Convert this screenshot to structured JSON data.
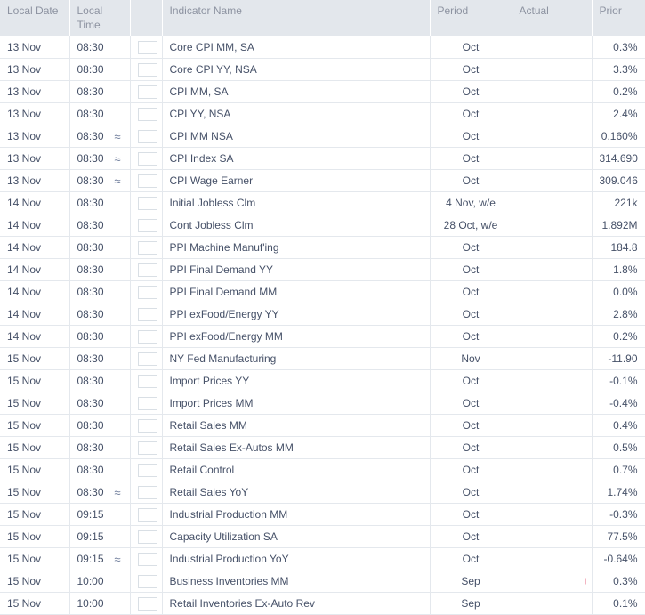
{
  "table": {
    "name": "economic-indicator-calendar",
    "columns": [
      {
        "key": "local_date",
        "label": "Local Date",
        "align": "left"
      },
      {
        "key": "local_time",
        "label": "Local Time",
        "align": "left"
      },
      {
        "key": "flag",
        "label": "",
        "align": "center"
      },
      {
        "key": "indicator_name",
        "label": "Indicator Name",
        "align": "left"
      },
      {
        "key": "period",
        "label": "Period",
        "align": "center"
      },
      {
        "key": "actual",
        "label": "Actual",
        "align": "right"
      },
      {
        "key": "prior",
        "label": "Prior",
        "align": "right"
      }
    ],
    "colors": {
      "header_background": "#e3e7ec",
      "header_text": "#8d93a1",
      "body_text": "#465168",
      "row_border": "#e4e8ed",
      "flag_red": "#e8808c",
      "flag_blue": "#3b4a7a"
    },
    "flag_icon_name": "us-flag-icon",
    "approx_symbol": "≈",
    "rows": [
      {
        "local_date": "13 Nov",
        "local_time": "08:30",
        "approx": false,
        "flag": "us-flag-icon",
        "indicator_name": "Core CPI MM, SA",
        "period": "Oct",
        "actual": "",
        "prior": "0.3%"
      },
      {
        "local_date": "13 Nov",
        "local_time": "08:30",
        "approx": false,
        "flag": "us-flag-icon",
        "indicator_name": "Core CPI YY, NSA",
        "period": "Oct",
        "actual": "",
        "prior": "3.3%"
      },
      {
        "local_date": "13 Nov",
        "local_time": "08:30",
        "approx": false,
        "flag": "us-flag-icon",
        "indicator_name": "CPI MM, SA",
        "period": "Oct",
        "actual": "",
        "prior": "0.2%"
      },
      {
        "local_date": "13 Nov",
        "local_time": "08:30",
        "approx": false,
        "flag": "us-flag-icon",
        "indicator_name": "CPI YY, NSA",
        "period": "Oct",
        "actual": "",
        "prior": "2.4%"
      },
      {
        "local_date": "13 Nov",
        "local_time": "08:30",
        "approx": true,
        "flag": "us-flag-icon",
        "indicator_name": "CPI MM NSA",
        "period": "Oct",
        "actual": "",
        "prior": "0.160%"
      },
      {
        "local_date": "13 Nov",
        "local_time": "08:30",
        "approx": true,
        "flag": "us-flag-icon",
        "indicator_name": "CPI Index SA",
        "period": "Oct",
        "actual": "",
        "prior": "314.690"
      },
      {
        "local_date": "13 Nov",
        "local_time": "08:30",
        "approx": true,
        "flag": "us-flag-icon",
        "indicator_name": "CPI Wage Earner",
        "period": "Oct",
        "actual": "",
        "prior": "309.046"
      },
      {
        "local_date": "14 Nov",
        "local_time": "08:30",
        "approx": false,
        "flag": "us-flag-icon",
        "indicator_name": "Initial Jobless Clm",
        "period": "4 Nov, w/e",
        "actual": "",
        "prior": "221k"
      },
      {
        "local_date": "14 Nov",
        "local_time": "08:30",
        "approx": false,
        "flag": "us-flag-icon",
        "indicator_name": "Cont Jobless Clm",
        "period": "28 Oct, w/e",
        "actual": "",
        "prior": "1.892M"
      },
      {
        "local_date": "14 Nov",
        "local_time": "08:30",
        "approx": false,
        "flag": "us-flag-icon",
        "indicator_name": "PPI Machine Manuf'ing",
        "period": "Oct",
        "actual": "",
        "prior": "184.8"
      },
      {
        "local_date": "14 Nov",
        "local_time": "08:30",
        "approx": false,
        "flag": "us-flag-icon",
        "indicator_name": "PPI Final Demand YY",
        "period": "Oct",
        "actual": "",
        "prior": "1.8%"
      },
      {
        "local_date": "14 Nov",
        "local_time": "08:30",
        "approx": false,
        "flag": "us-flag-icon",
        "indicator_name": "PPI Final Demand MM",
        "period": "Oct",
        "actual": "",
        "prior": "0.0%"
      },
      {
        "local_date": "14 Nov",
        "local_time": "08:30",
        "approx": false,
        "flag": "us-flag-icon",
        "indicator_name": "PPI exFood/Energy YY",
        "period": "Oct",
        "actual": "",
        "prior": "2.8%"
      },
      {
        "local_date": "14 Nov",
        "local_time": "08:30",
        "approx": false,
        "flag": "us-flag-icon",
        "indicator_name": "PPI exFood/Energy MM",
        "period": "Oct",
        "actual": "",
        "prior": "0.2%"
      },
      {
        "local_date": "15 Nov",
        "local_time": "08:30",
        "approx": false,
        "flag": "us-flag-icon",
        "indicator_name": "NY Fed Manufacturing",
        "period": "Nov",
        "actual": "",
        "prior": "-11.90"
      },
      {
        "local_date": "15 Nov",
        "local_time": "08:30",
        "approx": false,
        "flag": "us-flag-icon",
        "indicator_name": "Import Prices YY",
        "period": "Oct",
        "actual": "",
        "prior": "-0.1%"
      },
      {
        "local_date": "15 Nov",
        "local_time": "08:30",
        "approx": false,
        "flag": "us-flag-icon",
        "indicator_name": "Import Prices MM",
        "period": "Oct",
        "actual": "",
        "prior": "-0.4%"
      },
      {
        "local_date": "15 Nov",
        "local_time": "08:30",
        "approx": false,
        "flag": "us-flag-icon",
        "indicator_name": "Retail Sales MM",
        "period": "Oct",
        "actual": "",
        "prior": "0.4%"
      },
      {
        "local_date": "15 Nov",
        "local_time": "08:30",
        "approx": false,
        "flag": "us-flag-icon",
        "indicator_name": "Retail Sales Ex-Autos MM",
        "period": "Oct",
        "actual": "",
        "prior": "0.5%"
      },
      {
        "local_date": "15 Nov",
        "local_time": "08:30",
        "approx": false,
        "flag": "us-flag-icon",
        "indicator_name": "Retail Control",
        "period": "Oct",
        "actual": "",
        "prior": "0.7%"
      },
      {
        "local_date": "15 Nov",
        "local_time": "08:30",
        "approx": true,
        "flag": "us-flag-icon",
        "indicator_name": "Retail Sales YoY",
        "period": "Oct",
        "actual": "",
        "prior": "1.74%"
      },
      {
        "local_date": "15 Nov",
        "local_time": "09:15",
        "approx": false,
        "flag": "us-flag-icon",
        "indicator_name": "Industrial Production MM",
        "period": "Oct",
        "actual": "",
        "prior": "-0.3%"
      },
      {
        "local_date": "15 Nov",
        "local_time": "09:15",
        "approx": false,
        "flag": "us-flag-icon",
        "indicator_name": "Capacity Utilization SA",
        "period": "Oct",
        "actual": "",
        "prior": "77.5%"
      },
      {
        "local_date": "15 Nov",
        "local_time": "09:15",
        "approx": true,
        "flag": "us-flag-icon",
        "indicator_name": "Industrial Production YoY",
        "period": "Oct",
        "actual": "",
        "prior": "-0.64%"
      },
      {
        "local_date": "15 Nov",
        "local_time": "10:00",
        "approx": false,
        "flag": "us-flag-icon",
        "indicator_name": "Business Inventories MM",
        "period": "Sep",
        "actual": "",
        "actual_marker": true,
        "prior": "0.3%"
      },
      {
        "local_date": "15 Nov",
        "local_time": "10:00",
        "approx": false,
        "flag": "us-flag-icon",
        "indicator_name": "Retail Inventories Ex-Auto Rev",
        "period": "Sep",
        "actual": "",
        "prior": "0.1%"
      }
    ]
  }
}
